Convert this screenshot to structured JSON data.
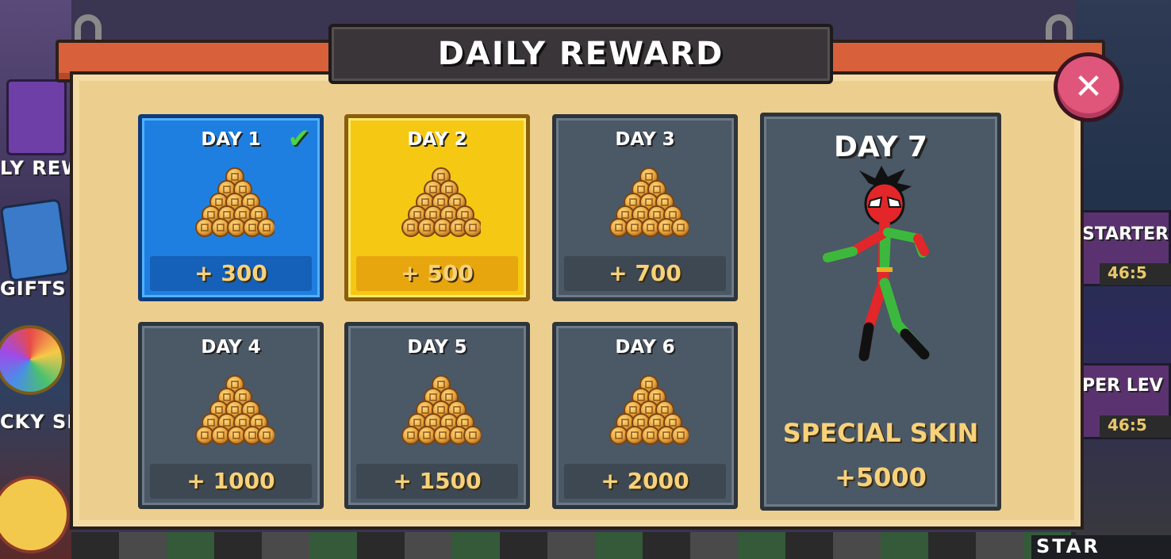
{
  "dialog": {
    "title": "DAILY REWARD",
    "close_icon": "close-icon"
  },
  "rewards": [
    {
      "day": "DAY 1",
      "amount": "+ 300",
      "state": "claimed"
    },
    {
      "day": "DAY 2",
      "amount": "+ 500",
      "state": "current"
    },
    {
      "day": "DAY 3",
      "amount": "+ 700",
      "state": "locked"
    },
    {
      "day": "DAY 4",
      "amount": "+ 1000",
      "state": "locked"
    },
    {
      "day": "DAY 5",
      "amount": "+ 1500",
      "state": "locked"
    },
    {
      "day": "DAY 6",
      "amount": "+ 2000",
      "state": "locked"
    }
  ],
  "day7": {
    "day": "DAY 7",
    "reward_label": "SPECIAL SKIN",
    "amount": "+5000"
  },
  "background": {
    "left_labels": [
      "LY REW",
      "GIFTS",
      "CKY SP"
    ],
    "right_labels": [
      "STARTER",
      "PER LEV"
    ],
    "right_timers": [
      "46:5",
      "46:5"
    ],
    "start_label": "STAR"
  },
  "colors": {
    "claimed": "#1f7fe0",
    "current": "#f5c814",
    "locked": "#4b5865",
    "gold_text": "#f7d27a",
    "close_button": "#e0567a"
  }
}
